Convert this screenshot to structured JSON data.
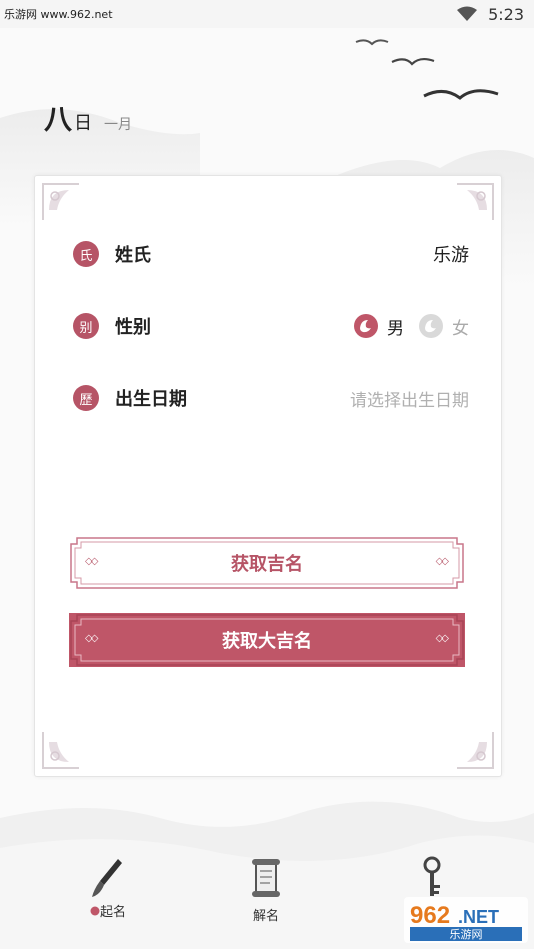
{
  "status_bar": {
    "watermark": "乐游网 www.962.net",
    "time": "5:23"
  },
  "date": {
    "day": "八",
    "day_suffix": "日",
    "month": "一月"
  },
  "form": {
    "surname": {
      "seal": "氏",
      "label": "姓氏",
      "value": "乐游"
    },
    "gender": {
      "seal": "别",
      "label": "性别",
      "options": [
        {
          "label": "男",
          "selected": true
        },
        {
          "label": "女",
          "selected": false
        }
      ]
    },
    "birthdate": {
      "seal": "歷",
      "label": "出生日期",
      "placeholder": "请选择出生日期"
    }
  },
  "buttons": {
    "get_good_name": "获取吉名",
    "get_great_name": "获取大吉名",
    "diamonds": "◇◇"
  },
  "bottom_nav": [
    {
      "label": "起名",
      "icon": "brush-icon",
      "active": true
    },
    {
      "label": "解名",
      "icon": "scroll-icon",
      "active": false
    },
    {
      "label": "",
      "icon": "hourglass-key-icon",
      "active": false
    }
  ],
  "watermark_logo": {
    "brand": "962",
    "suffix": ".NET",
    "sub": "乐游网"
  },
  "colors": {
    "accent": "#bf5668",
    "accent_dark": "#b65466",
    "text": "#222222",
    "placeholder": "#b0b0b0"
  }
}
